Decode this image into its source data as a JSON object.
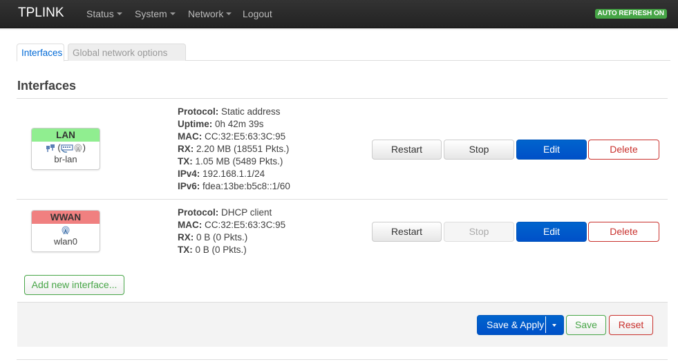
{
  "navbar": {
    "brand": "TPLINK",
    "menu": [
      {
        "label": "Status",
        "has_dropdown": true
      },
      {
        "label": "System",
        "has_dropdown": true
      },
      {
        "label": "Network",
        "has_dropdown": true
      },
      {
        "label": "Logout",
        "has_dropdown": false
      }
    ],
    "auto_refresh": "AUTO REFRESH ON"
  },
  "tabs": [
    {
      "label": "Interfaces",
      "active": true
    },
    {
      "label": "Global network options",
      "active": false
    }
  ],
  "section_title": "Interfaces",
  "interfaces": [
    {
      "name": "LAN",
      "header_color": "#90ee90",
      "icons": [
        "ethernet-switch-icon",
        "bridge-open-paren",
        "ethernet-adapter-icon",
        "wifi-icon",
        "bridge-close-paren"
      ],
      "device": "br-lan",
      "details": [
        {
          "label": "Protocol:",
          "value": "Static address"
        },
        {
          "label": "Uptime:",
          "value": "0h 42m 39s"
        },
        {
          "label": "MAC:",
          "value": "CC:32:E5:63:3C:95"
        },
        {
          "label": "RX:",
          "value": "2.20 MB (18551 Pkts.)"
        },
        {
          "label": "TX:",
          "value": "1.05 MB (5489 Pkts.)"
        },
        {
          "label": "IPv4:",
          "value": "192.168.1.1/24"
        },
        {
          "label": "IPv6:",
          "value": "fdea:13be:b5c8::1/60"
        }
      ],
      "actions": {
        "restart": "Restart",
        "stop": "Stop",
        "edit": "Edit",
        "delete": "Delete"
      },
      "stop_enabled": true
    },
    {
      "name": "WWAN",
      "header_color": "#f08080",
      "icons": [
        "wifi-icon"
      ],
      "device": "wlan0",
      "details": [
        {
          "label": "Protocol:",
          "value": "DHCP client"
        },
        {
          "label": "MAC:",
          "value": "CC:32:E5:63:3C:95"
        },
        {
          "label": "RX:",
          "value": "0 B (0 Pkts.)"
        },
        {
          "label": "TX:",
          "value": "0 B (0 Pkts.)"
        }
      ],
      "actions": {
        "restart": "Restart",
        "stop": "Stop",
        "edit": "Edit",
        "delete": "Delete"
      },
      "stop_enabled": false
    }
  ],
  "add_interface": "Add new interface...",
  "footer": {
    "save_apply": "Save & Apply",
    "save": "Save",
    "reset": "Reset"
  },
  "colors": {
    "accent_blue": "#0069d6",
    "primary_button": "#0064cd",
    "success_green": "#46a546",
    "danger_red": "#c9302c",
    "lan_header": "#90ee90",
    "wwan_header": "#f08080"
  }
}
